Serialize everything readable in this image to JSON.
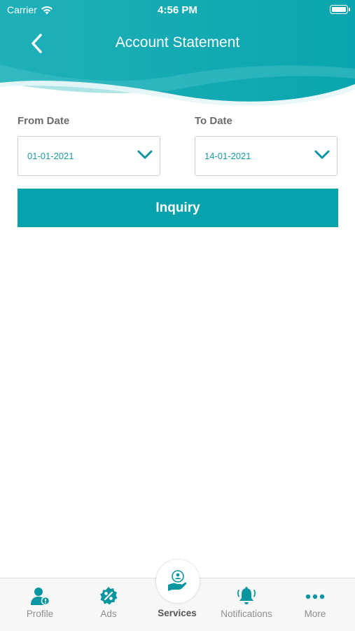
{
  "status_bar": {
    "carrier": "Carrier",
    "time": "4:56 PM"
  },
  "header": {
    "title": "Account Statement"
  },
  "form": {
    "from_label": "From Date",
    "from_value": "01-01-2021",
    "to_label": "To Date",
    "to_value": "14-01-2021",
    "inquiry_label": "Inquiry"
  },
  "tabbar": {
    "items": [
      {
        "label": "Profile",
        "icon": "profile-icon"
      },
      {
        "label": "Ads",
        "icon": "percent-badge-icon"
      },
      {
        "label": "Services",
        "icon": "services-hand-icon",
        "active": true
      },
      {
        "label": "Notifications",
        "icon": "bell-icon"
      },
      {
        "label": "More",
        "icon": "more-dots-icon"
      }
    ]
  },
  "colors": {
    "primary": "#08a2ac",
    "primary_dark": "#0a96a0",
    "label_gray": "#6b6b6b",
    "value_teal": "#1a9aa5"
  }
}
